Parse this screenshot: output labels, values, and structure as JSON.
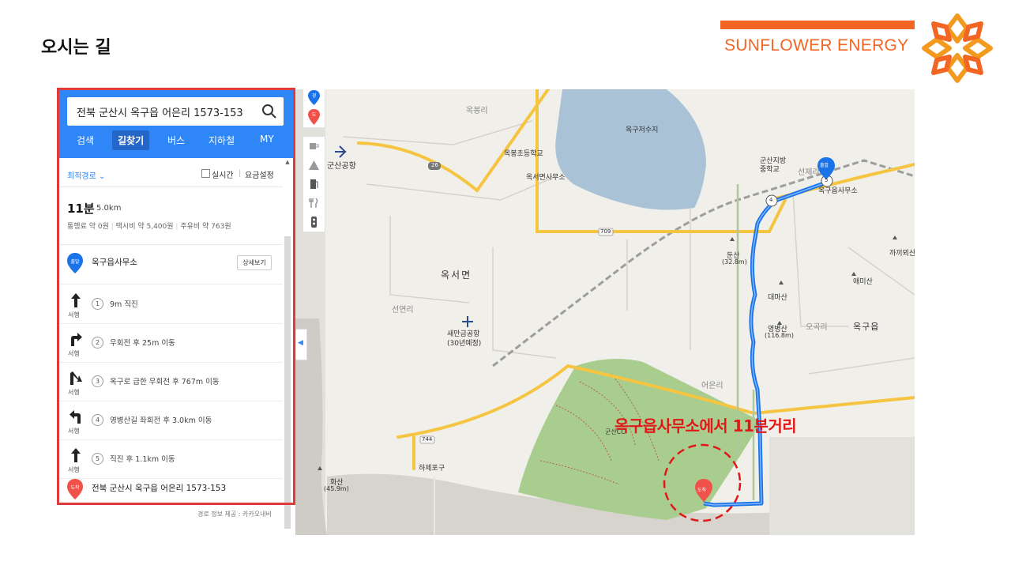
{
  "header": {
    "title": "오시는 길",
    "brand_name": "SUNFLOWER ENERGY",
    "brand_color": "#f26522"
  },
  "search": {
    "query": "전북 군산시 옥구읍 어은리 1573-153",
    "icon": "search-icon"
  },
  "tabs": [
    {
      "label": "검색",
      "active": false
    },
    {
      "label": "길찾기",
      "active": true
    },
    {
      "label": "버스",
      "active": false
    },
    {
      "label": "지하철",
      "active": false
    },
    {
      "label": "MY",
      "active": false
    }
  ],
  "options": {
    "route_type": "최적경로",
    "realtime": "실시간",
    "fare_settings": "요금설정"
  },
  "summary": {
    "time": "11분",
    "distance": "5.0km",
    "toll": "통행료 약 0원",
    "taxi": "택시비 약 5,400원",
    "fuel": "주유비 약 763원"
  },
  "start": {
    "badge": "출발",
    "name": "옥구읍사무소",
    "detail_label": "상세보기"
  },
  "steps": [
    {
      "num": "1",
      "dir": "서행",
      "text": "9m 직진",
      "icon": "arrow-straight-icon"
    },
    {
      "num": "2",
      "dir": "서행",
      "text": "우회전 후 25m 이동",
      "icon": "arrow-right-icon"
    },
    {
      "num": "3",
      "dir": "서행",
      "text": "옥구로 급한 우회전 후 767m 이동",
      "icon": "arrow-sharp-right-icon"
    },
    {
      "num": "4",
      "dir": "서행",
      "text": "영병산길 좌회전 후 3.0km 이동",
      "icon": "arrow-left-icon"
    },
    {
      "num": "5",
      "dir": "서행",
      "text": "직진 후 1.1km 이동",
      "icon": "arrow-straight-icon"
    }
  ],
  "end": {
    "badge": "도착",
    "name": "전북 군산시 옥구읍 어은리 1573-153"
  },
  "credit": "경로 정보 제공 : 카카오내비",
  "map": {
    "toolbar_badges": {
      "start": "경",
      "end": "도"
    },
    "labels": {
      "okbong": "옥봉리",
      "reservoir": "옥구저수지",
      "airport": "군산공항",
      "school": "옥봉초등학교",
      "okseo_office": "옥서면사무소",
      "gunsan_school": "군산지방\n중학교",
      "seje": "선제리",
      "okgu_office": "옥구읍사무소",
      "dunsan": "둔산",
      "dunsan_h": "(32.8m)",
      "kkakki": "까끼뫼산",
      "okseo_myeon": "옥서면",
      "aemisan": "애미산",
      "daemisan": "대마산",
      "seonyeon": "선연리",
      "new_airport_1": "새만금공항",
      "new_airport_2": "(30년예정)",
      "yeongbyeong": "영병산",
      "yeongbyeong_h": "(116.8m)",
      "okgok": "오곡리",
      "okgu_eup": "옥구읍",
      "eoeun": "어은리",
      "gunsan_cc": "군산CC",
      "haje": "하제포구",
      "hwasan": "화산",
      "hwasan_h": "(45.9m)",
      "end_badge": "도착",
      "start_badge": "출발",
      "road_26": "26",
      "road_709": "709",
      "road_744": "744",
      "road_4": "4",
      "road_5": "5"
    },
    "annotation": "옥구읍사무소에서 11분거리"
  }
}
